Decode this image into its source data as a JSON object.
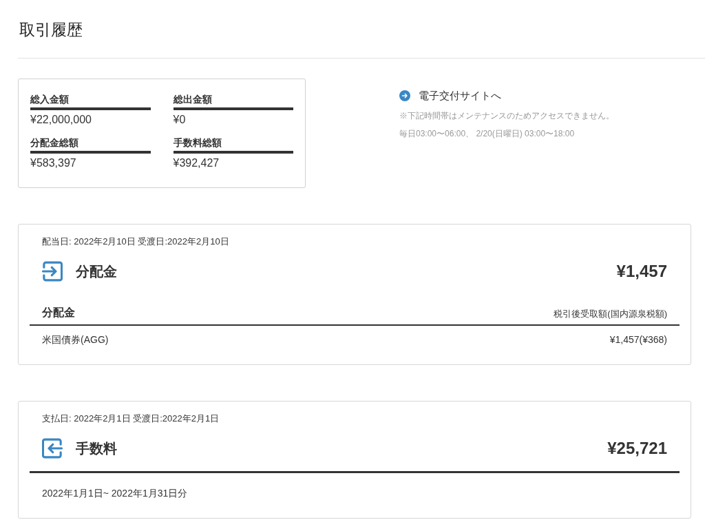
{
  "page_title": "取引履歴",
  "summary": {
    "items": [
      {
        "label": "総入金額",
        "value": "¥22,000,000"
      },
      {
        "label": "総出金額",
        "value": "¥0"
      },
      {
        "label": "分配金総額",
        "value": "¥583,397"
      },
      {
        "label": "手数料総額",
        "value": "¥392,427"
      }
    ]
  },
  "e_delivery": {
    "link": "電子交付サイトへ",
    "notes": [
      "※下記時間帯はメンテナンスのためアクセスできません。",
      "毎日03:00〜06:00、 2/20(日曜日) 03:00〜18:00"
    ]
  },
  "transactions": [
    {
      "kind": "distribution",
      "dates": "配当日: 2022年2月10日 受渡日:2022年2月10日",
      "title": "分配金",
      "amount": "¥1,457",
      "table": {
        "columns": [
          "分配金",
          "税引後受取額(国内源泉税額)"
        ],
        "rows": [
          [
            "米国債券(AGG)",
            "¥1,457(¥368)"
          ]
        ]
      }
    },
    {
      "kind": "fee",
      "dates": "支払日: 2022年2月1日 受渡日:2022年2月1日",
      "title": "手数料",
      "amount": "¥25,721",
      "period": "2022年1月1日~ 2022年1月31日分"
    }
  ]
}
